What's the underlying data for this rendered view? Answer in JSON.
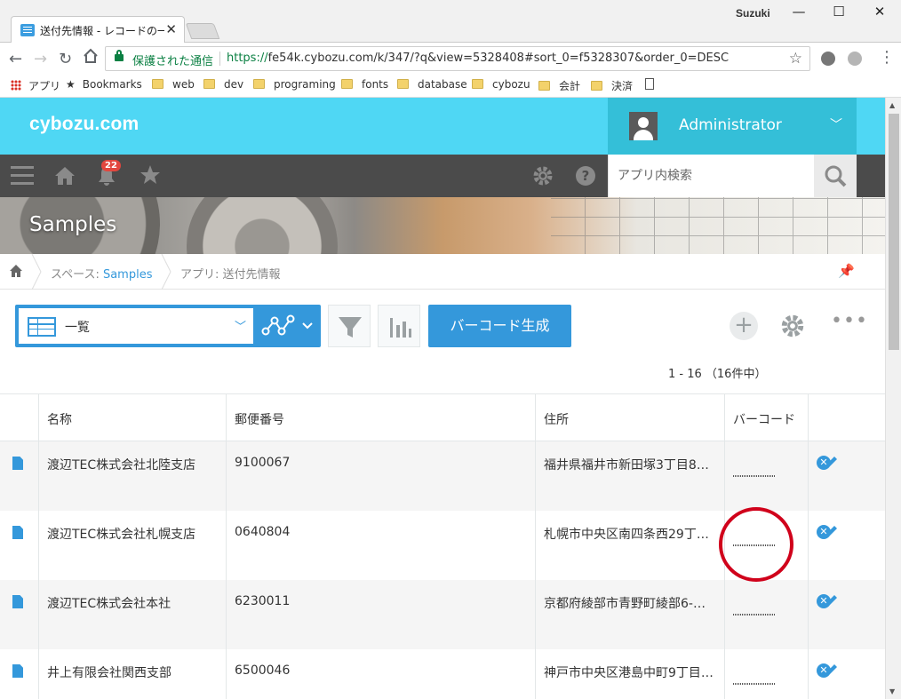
{
  "browser": {
    "tab_title": "送付先情報 - レコードの一覧",
    "window_user": "Suzuki",
    "secure_label": "保護された通信",
    "url_protocol": "https://",
    "url_rest": "fe54k.cybozu.com/k/347/?q&view=5328408#sort_0=f5328307&order_0=DESC",
    "bookmarks": [
      "アプリ",
      "Bookmarks",
      "web",
      "dev",
      "programing",
      "fonts",
      "database",
      "cybozu",
      "会計",
      "決済"
    ]
  },
  "header": {
    "logo": "cybozu.com",
    "username": "Administrator",
    "notification_count": "22",
    "search_placeholder": "アプリ内検索"
  },
  "banner": {
    "title": "Samples"
  },
  "breadcrumb": {
    "space_prefix": "スペース: ",
    "space_name": "Samples",
    "app_label": "アプリ: 送付先情報"
  },
  "toolbar": {
    "view_name": "一覧",
    "barcode_button": "バーコード生成",
    "pager": "1 - 16 （16件中）"
  },
  "table": {
    "columns": [
      "名称",
      "郵便番号",
      "住所",
      "バーコード"
    ],
    "rows": [
      {
        "name": "渡辺TEC株式会社北陸支店",
        "zip": "9100067",
        "address": "福井県福井市新田塚3丁目8…"
      },
      {
        "name": "渡辺TEC株式会社札幌支店",
        "zip": "0640804",
        "address": "札幌市中央区南四条西29丁…"
      },
      {
        "name": "渡辺TEC株式会社本社",
        "zip": "6230011",
        "address": "京都府綾部市青野町綾部6-…"
      },
      {
        "name": "井上有限会社関西支部",
        "zip": "6500046",
        "address": "神戸市中央区港島中町9丁目…"
      }
    ]
  },
  "colors": {
    "header_cyan": "#4fd7f4",
    "accent_blue": "#3498db",
    "annotation_red": "#d0021b"
  }
}
